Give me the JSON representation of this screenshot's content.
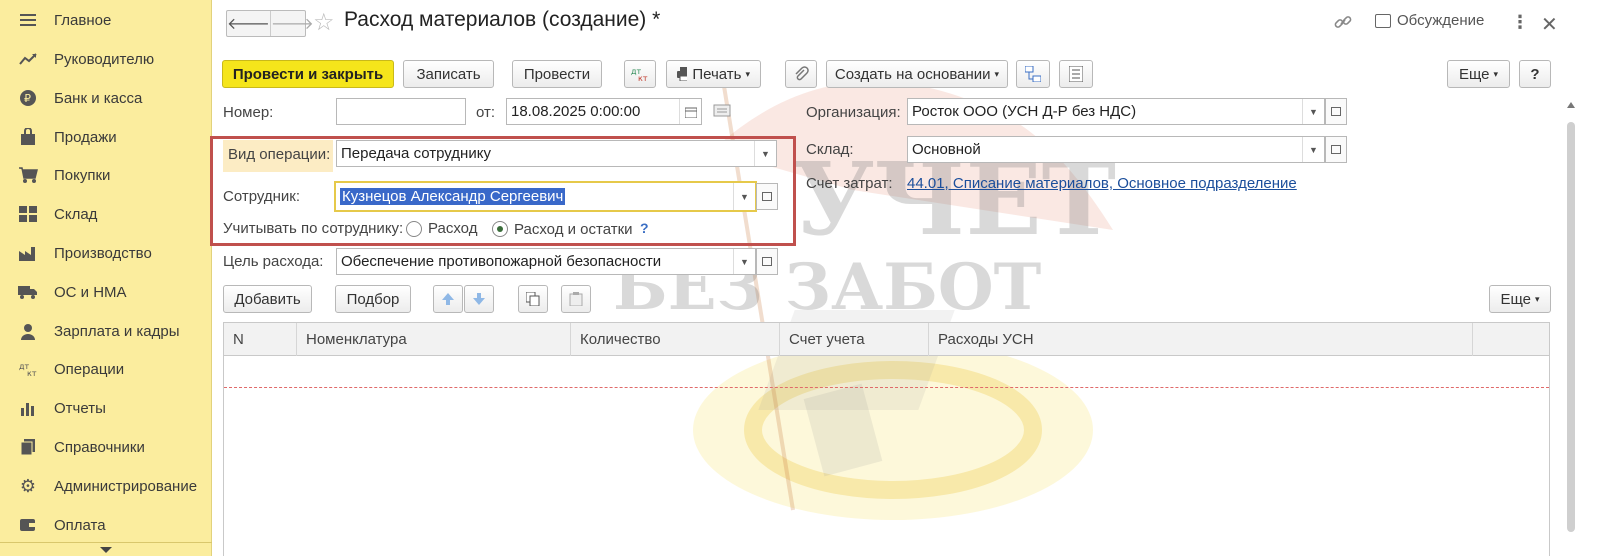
{
  "sidebar": {
    "items": [
      {
        "label": "Главное",
        "icon": "menu-icon"
      },
      {
        "label": "Руководителю",
        "icon": "trend-icon"
      },
      {
        "label": "Банк и касса",
        "icon": "ruble-icon"
      },
      {
        "label": "Продажи",
        "icon": "bag-icon"
      },
      {
        "label": "Покупки",
        "icon": "cart-icon"
      },
      {
        "label": "Склад",
        "icon": "warehouse-icon"
      },
      {
        "label": "Производство",
        "icon": "factory-icon"
      },
      {
        "label": "ОС и НМА",
        "icon": "truck-icon"
      },
      {
        "label": "Зарплата и кадры",
        "icon": "person-icon"
      },
      {
        "label": "Операции",
        "icon": "dt-kt-icon"
      },
      {
        "label": "Отчеты",
        "icon": "bar-chart-icon"
      },
      {
        "label": "Справочники",
        "icon": "books-icon"
      },
      {
        "label": "Администрирование",
        "icon": "gear-icon"
      },
      {
        "label": "Оплата",
        "icon": "wallet-icon"
      }
    ]
  },
  "header": {
    "title": "Расход материалов (создание) *",
    "discuss_label": "Обсуждение"
  },
  "toolbar": {
    "post_close": "Провести и закрыть",
    "save": "Записать",
    "post": "Провести",
    "print": "Печать",
    "create_based": "Создать на основании",
    "more": "Еще",
    "help": "?"
  },
  "form": {
    "number_label": "Номер:",
    "number_value": "",
    "from_label": "от:",
    "date_value": "18.08.2025  0:00:00",
    "org_label": "Организация:",
    "org_value": "Росток ООО (УСН Д-Р без НДС)",
    "operation_label": "Вид операции:",
    "operation_value": "Передача сотруднику",
    "warehouse_label": "Склад:",
    "warehouse_value": "Основной",
    "employee_label": "Сотрудник:",
    "employee_value": "Кузнецов Александр Сергеевич",
    "cost_account_label": "Счет затрат:",
    "cost_account_value": "44.01, Списание материалов, Основное подразделение",
    "track_label": "Учитывать по сотруднику:",
    "radio_expense": "Расход",
    "radio_expense_balance": "Расход и остатки",
    "radio_help": "?",
    "purpose_label": "Цель расхода:",
    "purpose_value": "Обеспечение противопожарной безопасности"
  },
  "table_toolbar": {
    "add": "Добавить",
    "pick": "Подбор",
    "more": "Еще"
  },
  "table": {
    "columns": [
      "N",
      "Номенклатура",
      "Количество",
      "Счет учета",
      "Расходы УСН"
    ]
  },
  "watermark": {
    "line1": "УЧЕТ",
    "line2": "БЕЗ ЗАБОТ"
  },
  "colors": {
    "sidebar_bg": "#fbed9e",
    "primary_button": "#f5e51b",
    "highlight_border": "#c0504d",
    "link": "#1b4e9b"
  }
}
